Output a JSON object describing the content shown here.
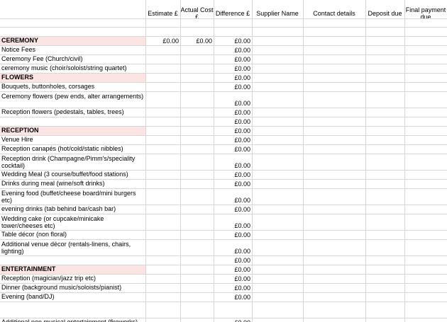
{
  "headers": [
    "",
    "Estimate £",
    "Actual Cost £",
    "Difference £",
    "Supplier Name",
    "Contact details",
    "Deposit due",
    "Final payment due"
  ],
  "rows": [
    {
      "label": "",
      "type": "blank",
      "values": [
        "",
        "",
        ""
      ]
    },
    {
      "label": "CEREMONY",
      "type": "section",
      "values": [
        "£0.00",
        "£0.00",
        "£0.00"
      ]
    },
    {
      "label": "Notice Fees",
      "type": "item",
      "values": [
        "",
        "",
        "£0.00"
      ]
    },
    {
      "label": "Ceremony Fee (Church/civil)",
      "type": "item",
      "values": [
        "",
        "",
        "£0.00"
      ]
    },
    {
      "label": "ceremony music (choir/soloist/string quartet)",
      "type": "item",
      "values": [
        "",
        "",
        "£0.00"
      ]
    },
    {
      "label": "FLOWERS",
      "type": "section",
      "values": [
        "",
        "",
        "£0.00"
      ]
    },
    {
      "label": "Bouquets, buttonholes, corsages",
      "type": "item",
      "values": [
        "",
        "",
        "£0.00"
      ]
    },
    {
      "label": "Ceremony flowers (pew ends, alter arrangements)",
      "type": "item",
      "wrap": true,
      "values": [
        "",
        "",
        "£0.00"
      ]
    },
    {
      "label": "Reception flowers (pedestals, tables, trees)",
      "type": "item",
      "values": [
        "",
        "",
        "£0.00"
      ]
    },
    {
      "label": "",
      "type": "blank",
      "values": [
        "",
        "",
        "£0.00"
      ]
    },
    {
      "label": "RECEPTION",
      "type": "section",
      "values": [
        "",
        "",
        "£0.00"
      ]
    },
    {
      "label": "Venue Hire",
      "type": "item",
      "values": [
        "",
        "",
        "£0.00"
      ]
    },
    {
      "label": "Reception canapés (hot/cold/static nibbles)",
      "type": "item",
      "values": [
        "",
        "",
        "£0.00"
      ]
    },
    {
      "label": "Reception drink (Champagne/Pimm's/speciality cocktail)",
      "type": "item",
      "wrap": true,
      "values": [
        "",
        "",
        "£0.00"
      ]
    },
    {
      "label": "Wedding Meal (3 course/buffet/food stations)",
      "type": "item",
      "values": [
        "",
        "",
        "£0.00"
      ]
    },
    {
      "label": "Drinks during meal (wine/soft drinks)",
      "type": "item",
      "values": [
        "",
        "",
        "£0.00"
      ]
    },
    {
      "label": "Evening food (buffet/cheese board/mini burgers etc)",
      "type": "item",
      "wrap": true,
      "values": [
        "",
        "",
        "£0.00"
      ]
    },
    {
      "label": "evening drinks (tab behind bar/cash bar)",
      "type": "item",
      "values": [
        "",
        "",
        "£0.00"
      ]
    },
    {
      "label": "Wedding cake (or cupcake/minicake tower/cheeses etc)",
      "type": "item",
      "wrap": true,
      "values": [
        "",
        "",
        "£0.00"
      ]
    },
    {
      "label": "Table décor (non floral)",
      "type": "item",
      "values": [
        "",
        "",
        "£0.00"
      ]
    },
    {
      "label": "Additional venue décor (rentals-linens, chairs, lighting)",
      "type": "item",
      "wrap": true,
      "values": [
        "",
        "",
        "£0.00"
      ]
    },
    {
      "label": "",
      "type": "blank",
      "values": [
        "",
        "",
        "£0.00"
      ]
    },
    {
      "label": "ENTERTAINMENT",
      "type": "section",
      "values": [
        "",
        "",
        "£0.00"
      ]
    },
    {
      "label": "Reception (magician/jazz trip etc)",
      "type": "item",
      "values": [
        "",
        "",
        "£0.00"
      ]
    },
    {
      "label": "Dinner (background music/soloists/pianist)",
      "type": "item",
      "values": [
        "",
        "",
        "£0.00"
      ]
    },
    {
      "label": "Evening (band/DJ)",
      "type": "item",
      "values": [
        "",
        "",
        "£0.00"
      ]
    },
    {
      "label": "",
      "type": "blank",
      "values": [
        "",
        "",
        ""
      ]
    },
    {
      "label": "Additional non musical entertainment (fireworks)",
      "type": "item",
      "values": [
        "",
        "",
        "£0.00"
      ]
    }
  ],
  "colors": {
    "section_fill": "#fbe4e4",
    "grid": "#d7d7d7"
  }
}
